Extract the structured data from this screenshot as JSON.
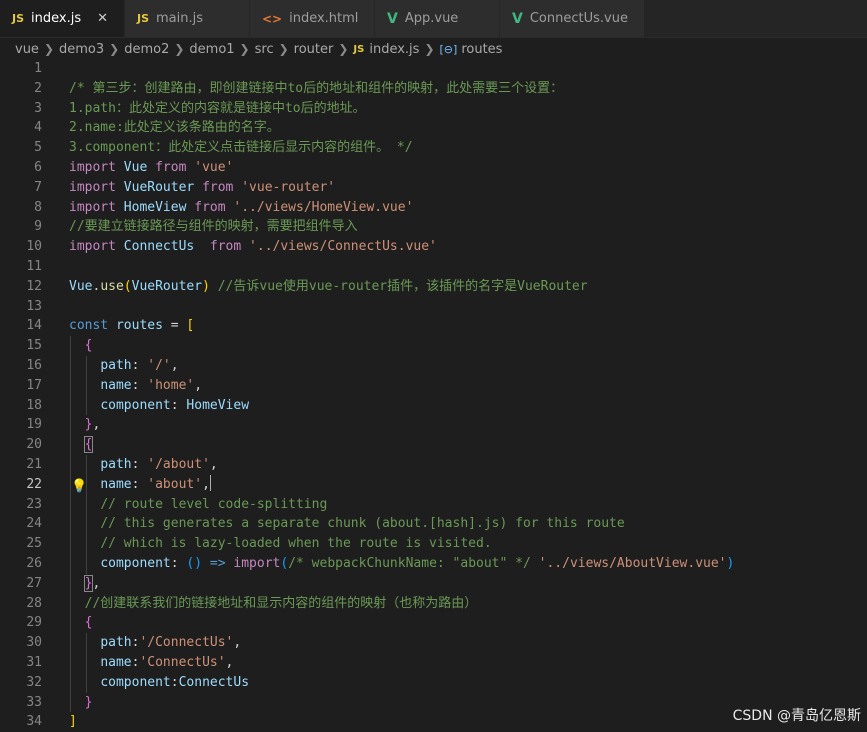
{
  "tabs": [
    {
      "label": "index.js",
      "icon": "js-file-icon",
      "glyph": "JS",
      "active": true,
      "close": "✕"
    },
    {
      "label": "main.js",
      "icon": "js-file-icon",
      "glyph": "JS",
      "active": false
    },
    {
      "label": "index.html",
      "icon": "html-file-icon",
      "glyph": "<>",
      "active": false
    },
    {
      "label": "App.vue",
      "icon": "vue-file-icon",
      "glyph": "V",
      "active": false
    },
    {
      "label": "ConnectUs.vue",
      "icon": "vue-file-icon",
      "glyph": "V",
      "active": false
    }
  ],
  "breadcrumb": {
    "items": [
      "vue",
      "demo3",
      "demo2",
      "demo1",
      "src",
      "router",
      "index.js",
      "routes"
    ],
    "file_glyph": "JS",
    "symbol_glyph": "[⊖]"
  },
  "editor": {
    "current_line": 22,
    "lightbulb_line": 22,
    "lines": [
      {
        "n": "1",
        "tokens": []
      },
      {
        "n": "2",
        "tokens": [
          [
            "cm",
            "/* 第三步：创建路由，即创建链接中to后的地址和组件的映射，此处需要三个设置："
          ]
        ]
      },
      {
        "n": "3",
        "tokens": [
          [
            "cm",
            "1.path：此处定义的内容就是链接中to后的地址。"
          ]
        ]
      },
      {
        "n": "4",
        "tokens": [
          [
            "cm",
            "2.name:此处定义该条路由的名字。"
          ]
        ]
      },
      {
        "n": "5",
        "tokens": [
          [
            "cm",
            "3.component：此处定义点击链接后显示内容的组件。 */"
          ]
        ]
      },
      {
        "n": "6",
        "tokens": [
          [
            "kw",
            "import"
          ],
          [
            "pl",
            " "
          ],
          [
            "vr",
            "Vue"
          ],
          [
            "pl",
            " "
          ],
          [
            "kw",
            "from"
          ],
          [
            "pl",
            " "
          ],
          [
            "st",
            "'vue'"
          ]
        ]
      },
      {
        "n": "7",
        "tokens": [
          [
            "kw",
            "import"
          ],
          [
            "pl",
            " "
          ],
          [
            "vr",
            "VueRouter"
          ],
          [
            "pl",
            " "
          ],
          [
            "kw",
            "from"
          ],
          [
            "pl",
            " "
          ],
          [
            "st",
            "'vue-router'"
          ]
        ]
      },
      {
        "n": "8",
        "tokens": [
          [
            "kw",
            "import"
          ],
          [
            "pl",
            " "
          ],
          [
            "vr",
            "HomeView"
          ],
          [
            "pl",
            " "
          ],
          [
            "kw",
            "from"
          ],
          [
            "pl",
            " "
          ],
          [
            "st",
            "'../views/HomeView.vue'"
          ]
        ]
      },
      {
        "n": "9",
        "tokens": [
          [
            "cm",
            "//要建立链接路径与组件的映射，需要把组件导入"
          ]
        ]
      },
      {
        "n": "10",
        "tokens": [
          [
            "kw",
            "import"
          ],
          [
            "pl",
            " "
          ],
          [
            "vr",
            "ConnectUs"
          ],
          [
            "pl",
            "  "
          ],
          [
            "kw",
            "from"
          ],
          [
            "pl",
            " "
          ],
          [
            "st",
            "'../views/ConnectUs.vue'"
          ]
        ]
      },
      {
        "n": "11",
        "tokens": []
      },
      {
        "n": "12",
        "tokens": [
          [
            "vr",
            "Vue"
          ],
          [
            "pl",
            "."
          ],
          [
            "fn",
            "use"
          ],
          [
            "br1",
            "("
          ],
          [
            "vr",
            "VueRouter"
          ],
          [
            "br1",
            ")"
          ],
          [
            "pl",
            " "
          ],
          [
            "cm",
            "//告诉vue使用vue-router插件，该插件的名字是VueRouter"
          ]
        ]
      },
      {
        "n": "13",
        "tokens": []
      },
      {
        "n": "14",
        "tokens": [
          [
            "bl",
            "const"
          ],
          [
            "pl",
            " "
          ],
          [
            "vr",
            "routes"
          ],
          [
            "pl",
            " = "
          ],
          [
            "br1",
            "["
          ]
        ]
      },
      {
        "n": "15",
        "tokens": [
          [
            "pl",
            "  "
          ],
          [
            "br2",
            "{"
          ]
        ]
      },
      {
        "n": "16",
        "tokens": [
          [
            "pl",
            "    "
          ],
          [
            "vr",
            "path"
          ],
          [
            "pl",
            ": "
          ],
          [
            "st",
            "'/'"
          ],
          [
            "pl",
            ","
          ]
        ]
      },
      {
        "n": "17",
        "tokens": [
          [
            "pl",
            "    "
          ],
          [
            "vr",
            "name"
          ],
          [
            "pl",
            ": "
          ],
          [
            "st",
            "'home'"
          ],
          [
            "pl",
            ","
          ]
        ]
      },
      {
        "n": "18",
        "tokens": [
          [
            "pl",
            "    "
          ],
          [
            "vr",
            "component"
          ],
          [
            "pl",
            ": "
          ],
          [
            "vr",
            "HomeView"
          ]
        ]
      },
      {
        "n": "19",
        "tokens": [
          [
            "pl",
            "  "
          ],
          [
            "br2",
            "}"
          ],
          [
            "pl",
            ","
          ]
        ]
      },
      {
        "n": "20",
        "tokens": [
          [
            "pl",
            "  "
          ],
          [
            "br2 t-mbox",
            "{"
          ]
        ]
      },
      {
        "n": "21",
        "tokens": [
          [
            "pl",
            "    "
          ],
          [
            "vr",
            "path"
          ],
          [
            "pl",
            ": "
          ],
          [
            "st",
            "'/about'"
          ],
          [
            "pl",
            ","
          ]
        ]
      },
      {
        "n": "22",
        "tokens": [
          [
            "pl",
            "    "
          ],
          [
            "vr",
            "name"
          ],
          [
            "pl",
            ": "
          ],
          [
            "st",
            "'about'"
          ],
          [
            "pl",
            ","
          ]
        ],
        "cursor": true
      },
      {
        "n": "23",
        "tokens": [
          [
            "pl",
            "    "
          ],
          [
            "cm",
            "// route level code-splitting"
          ]
        ]
      },
      {
        "n": "24",
        "tokens": [
          [
            "pl",
            "    "
          ],
          [
            "cm",
            "// this generates a separate chunk (about.[hash].js) for this route"
          ]
        ]
      },
      {
        "n": "25",
        "tokens": [
          [
            "pl",
            "    "
          ],
          [
            "cm",
            "// which is lazy-loaded when the route is visited."
          ]
        ]
      },
      {
        "n": "26",
        "tokens": [
          [
            "pl",
            "    "
          ],
          [
            "vr",
            "component"
          ],
          [
            "pl",
            ": "
          ],
          [
            "br3",
            "()"
          ],
          [
            "pl",
            " "
          ],
          [
            "bl",
            "=>"
          ],
          [
            "pl",
            " "
          ],
          [
            "kw",
            "import"
          ],
          [
            "br3",
            "("
          ],
          [
            "cm",
            "/* webpackChunkName: \"about\" */"
          ],
          [
            "pl",
            " "
          ],
          [
            "st",
            "'../views/AboutView.vue'"
          ],
          [
            "br3",
            ")"
          ]
        ]
      },
      {
        "n": "27",
        "tokens": [
          [
            "pl",
            "  "
          ],
          [
            "br2 t-mbox",
            "}"
          ],
          [
            "pl",
            ","
          ]
        ]
      },
      {
        "n": "28",
        "tokens": [
          [
            "pl",
            "  "
          ],
          [
            "cm",
            "//创建联系我们的链接地址和显示内容的组件的映射（也称为路由）"
          ]
        ]
      },
      {
        "n": "29",
        "tokens": [
          [
            "pl",
            "  "
          ],
          [
            "br2",
            "{"
          ]
        ]
      },
      {
        "n": "30",
        "tokens": [
          [
            "pl",
            "    "
          ],
          [
            "vr",
            "path"
          ],
          [
            "pl",
            ":"
          ],
          [
            "st",
            "'/ConnectUs'"
          ],
          [
            "pl",
            ","
          ]
        ]
      },
      {
        "n": "31",
        "tokens": [
          [
            "pl",
            "    "
          ],
          [
            "vr",
            "name"
          ],
          [
            "pl",
            ":"
          ],
          [
            "st",
            "'ConnectUs'"
          ],
          [
            "pl",
            ","
          ]
        ]
      },
      {
        "n": "32",
        "tokens": [
          [
            "pl",
            "    "
          ],
          [
            "vr",
            "component"
          ],
          [
            "pl",
            ":"
          ],
          [
            "vr",
            "ConnectUs"
          ]
        ]
      },
      {
        "n": "33",
        "tokens": [
          [
            "pl",
            "  "
          ],
          [
            "br2",
            "}"
          ]
        ]
      },
      {
        "n": "34",
        "tokens": [
          [
            "br1",
            "]"
          ]
        ]
      }
    ]
  },
  "watermark": "CSDN @青岛亿恩斯"
}
